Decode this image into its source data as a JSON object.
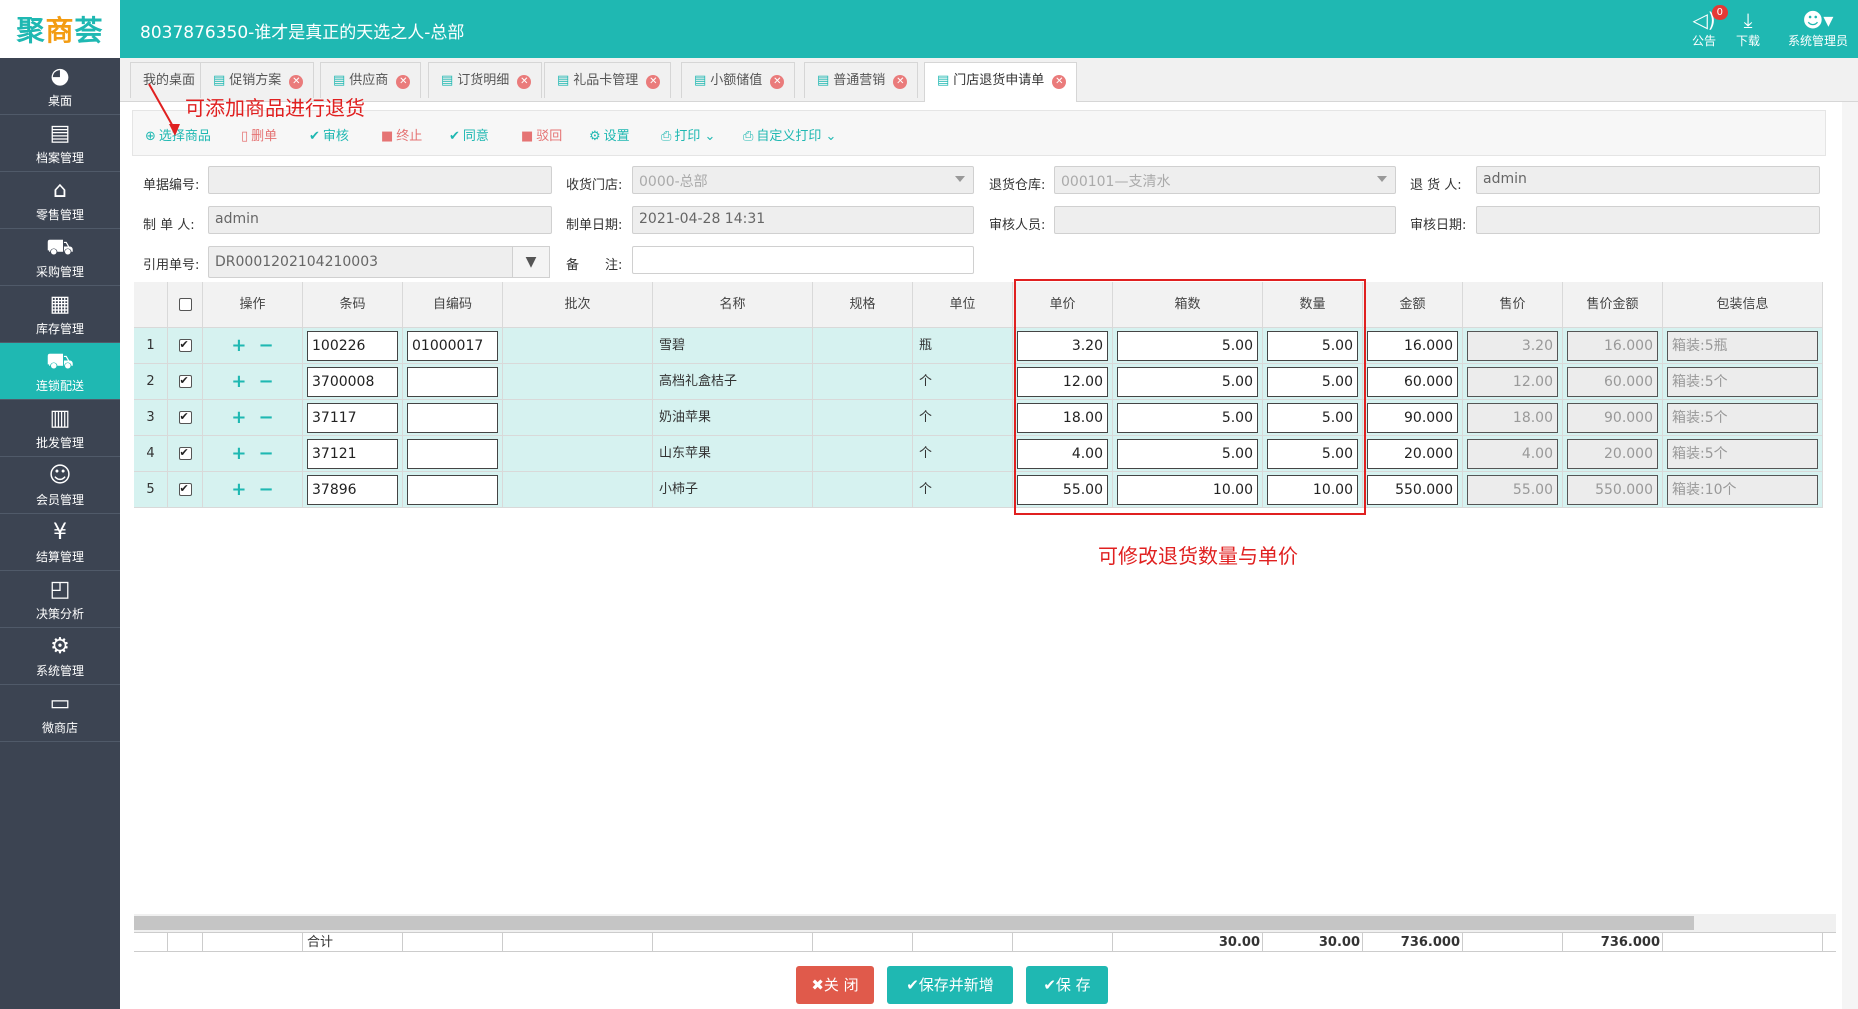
{
  "header": {
    "logo": [
      "聚",
      "商",
      "荟"
    ],
    "title": "8037876350-谁才是真正的天选之人-总部",
    "notice_label": "公告",
    "notice_count": "0",
    "download_label": "下载",
    "user_label": "系统管理员"
  },
  "sidebar": [
    {
      "label": "桌面",
      "icon": "dashboard-icon",
      "glyph": "◕"
    },
    {
      "label": "档案管理",
      "icon": "archive-icon",
      "glyph": "▤"
    },
    {
      "label": "零售管理",
      "icon": "store-icon",
      "glyph": "⌂"
    },
    {
      "label": "采购管理",
      "icon": "purchase-icon",
      "glyph": "⛟"
    },
    {
      "label": "库存管理",
      "icon": "inventory-icon",
      "glyph": "▦"
    },
    {
      "label": "连锁配送",
      "icon": "delivery-truck-icon",
      "glyph": "⛟"
    },
    {
      "label": "批发管理",
      "icon": "wholesale-icon",
      "glyph": "▥"
    },
    {
      "label": "会员管理",
      "icon": "member-icon",
      "glyph": "☺"
    },
    {
      "label": "结算管理",
      "icon": "settlement-icon",
      "glyph": "¥"
    },
    {
      "label": "决策分析",
      "icon": "analysis-icon",
      "glyph": "◰"
    },
    {
      "label": "系统管理",
      "icon": "gear-icon",
      "glyph": "⚙"
    },
    {
      "label": "微商店",
      "icon": "shop-icon",
      "glyph": "▭"
    }
  ],
  "sidebar_active": 5,
  "tabs": [
    {
      "label": "我的桌面",
      "closable": false
    },
    {
      "label": "促销方案",
      "closable": true
    },
    {
      "label": "供应商",
      "closable": true
    },
    {
      "label": "订货明细",
      "closable": true
    },
    {
      "label": "礼品卡管理",
      "closable": true
    },
    {
      "label": "小额储值",
      "closable": true
    },
    {
      "label": "普通营销",
      "closable": true
    },
    {
      "label": "门店退货申请单",
      "closable": true,
      "active": true
    }
  ],
  "toolbar": {
    "select_goods": "选择商品",
    "delete": "删单",
    "audit": "审核",
    "terminate": "终止",
    "agree": "同意",
    "reject": "驳回",
    "settings": "设置",
    "print": "打印",
    "custom_print": "自定义打印"
  },
  "annotations": {
    "add_goods": "可添加商品进行退货",
    "edit_qty": "可修改退货数量与单价"
  },
  "form": {
    "doc_no_label": "单据编号:",
    "doc_no": "",
    "recv_store_label": "收货门店:",
    "recv_store": "0000-总部",
    "return_wh_label": "退货仓库:",
    "return_wh": "000101—支清水",
    "returner_label": "退 货 人:",
    "returner": "admin",
    "maker_label": "制 单 人:",
    "maker": "admin",
    "make_date_label": "制单日期:",
    "make_date": "2021-04-28 14:31",
    "auditor_label": "审核人员:",
    "auditor": "",
    "audit_date_label": "审核日期:",
    "audit_date": "",
    "ref_no_label": "引用单号:",
    "ref_no": "DR0001202104210003",
    "remark_label": "备　　注:",
    "remark": ""
  },
  "grid": {
    "columns": [
      "",
      "",
      "操作",
      "条码",
      "自编码",
      "批次",
      "名称",
      "规格",
      "单位",
      "单价",
      "箱数",
      "数量",
      "金额",
      "售价",
      "售价金额",
      "包装信息"
    ],
    "rows": [
      {
        "no": "1",
        "barcode": "100226",
        "selfcode": "01000017",
        "batch": "",
        "name": "雪碧",
        "spec": "",
        "unit": "瓶",
        "price": "3.20",
        "boxes": "5.00",
        "qty": "5.00",
        "amount": "16.000",
        "sale_price": "3.20",
        "sale_amount": "16.000",
        "pack": "箱装:5瓶"
      },
      {
        "no": "2",
        "barcode": "3700008",
        "selfcode": "",
        "batch": "",
        "name": "高档礼盒桔子",
        "spec": "",
        "unit": "个",
        "price": "12.00",
        "boxes": "5.00",
        "qty": "5.00",
        "amount": "60.000",
        "sale_price": "12.00",
        "sale_amount": "60.000",
        "pack": "箱装:5个"
      },
      {
        "no": "3",
        "barcode": "37117",
        "selfcode": "",
        "batch": "",
        "name": "奶油苹果",
        "spec": "",
        "unit": "个",
        "price": "18.00",
        "boxes": "5.00",
        "qty": "5.00",
        "amount": "90.000",
        "sale_price": "18.00",
        "sale_amount": "90.000",
        "pack": "箱装:5个"
      },
      {
        "no": "4",
        "barcode": "37121",
        "selfcode": "",
        "batch": "",
        "name": "山东苹果",
        "spec": "",
        "unit": "个",
        "price": "4.00",
        "boxes": "5.00",
        "qty": "5.00",
        "amount": "20.000",
        "sale_price": "4.00",
        "sale_amount": "20.000",
        "pack": "箱装:5个"
      },
      {
        "no": "5",
        "barcode": "37896",
        "selfcode": "",
        "batch": "",
        "name": "小柿子",
        "spec": "",
        "unit": "个",
        "price": "55.00",
        "boxes": "10.00",
        "qty": "10.00",
        "amount": "550.000",
        "sale_price": "55.00",
        "sale_amount": "550.000",
        "pack": "箱装:10个"
      }
    ],
    "total_label": "合计",
    "total_boxes": "30.00",
    "total_qty": "30.00",
    "total_amount": "736.000",
    "total_sale_amount": "736.000"
  },
  "buttons": {
    "close": "关 闭",
    "save_new": "保存并新增",
    "save": "保 存"
  },
  "colors": {
    "accent": "#1fb8b2",
    "sidebar": "#3c4452",
    "danger": "#e05a4b",
    "annotation": "#e02020"
  }
}
